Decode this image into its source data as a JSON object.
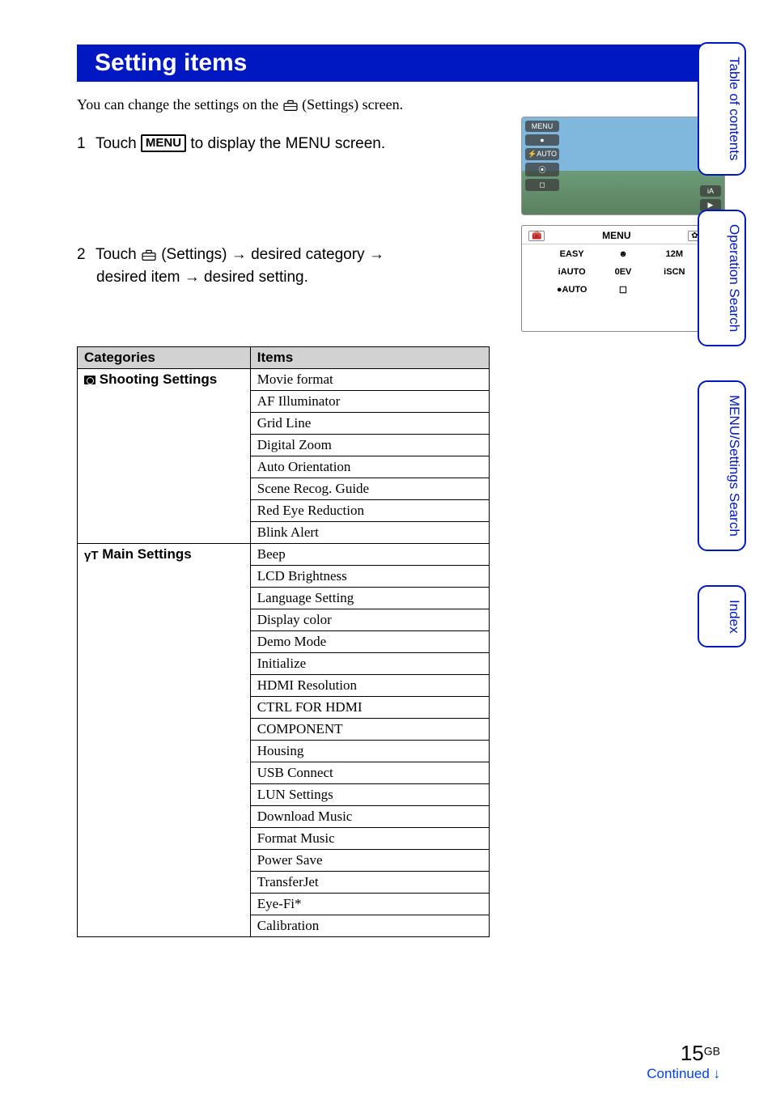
{
  "title": "Setting items",
  "intro_prefix": "You can change the settings on the ",
  "intro_suffix": " (Settings) screen.",
  "step1": {
    "num": "1",
    "prefix": "Touch ",
    "menu_label": "MENU",
    "suffix": " to display the MENU screen."
  },
  "step2": {
    "num": "2",
    "line1_prefix": "Touch ",
    "line1_mid": " (Settings) → desired category →",
    "line2": "desired item → desired setting."
  },
  "screenshot1": {
    "left_icons": [
      "MENU",
      "●",
      "⚡AUTO",
      "⦿",
      "◻"
    ],
    "right_icons": [
      "iA",
      "▶"
    ]
  },
  "screenshot2": {
    "menu_label": "MENU",
    "close": "✕",
    "gear": "✿",
    "toolbox": "🧰",
    "grid": [
      "EASY",
      "☻",
      "12M",
      "iAUTO",
      "0EV",
      "iSCN",
      "●AUTO",
      "☐",
      ""
    ]
  },
  "table": {
    "headers": {
      "categories": "Categories",
      "items": "Items"
    },
    "categories": [
      {
        "name": "Shooting Settings",
        "icon": "camera",
        "items": [
          "Movie format",
          "AF Illuminator",
          "Grid Line",
          "Digital Zoom",
          "Auto Orientation",
          "Scene Recog. Guide",
          "Red Eye Reduction",
          "Blink Alert"
        ]
      },
      {
        "name": "Main Settings",
        "icon": "tools",
        "items": [
          "Beep",
          "LCD Brightness",
          "Language Setting",
          "Display color",
          "Demo Mode",
          "Initialize",
          "HDMI Resolution",
          "CTRL FOR HDMI",
          "COMPONENT",
          "Housing",
          "USB Connect",
          "LUN Settings",
          "Download Music",
          "Format Music",
          "Power Save",
          "TransferJet",
          "Eye-Fi*",
          "Calibration"
        ]
      }
    ]
  },
  "side_tabs": [
    "Table of contents",
    "Operation Search",
    "MENU/Settings Search",
    "Index"
  ],
  "footer": {
    "continued": "Continued ↓",
    "page_num": "15",
    "gb": "GB"
  }
}
